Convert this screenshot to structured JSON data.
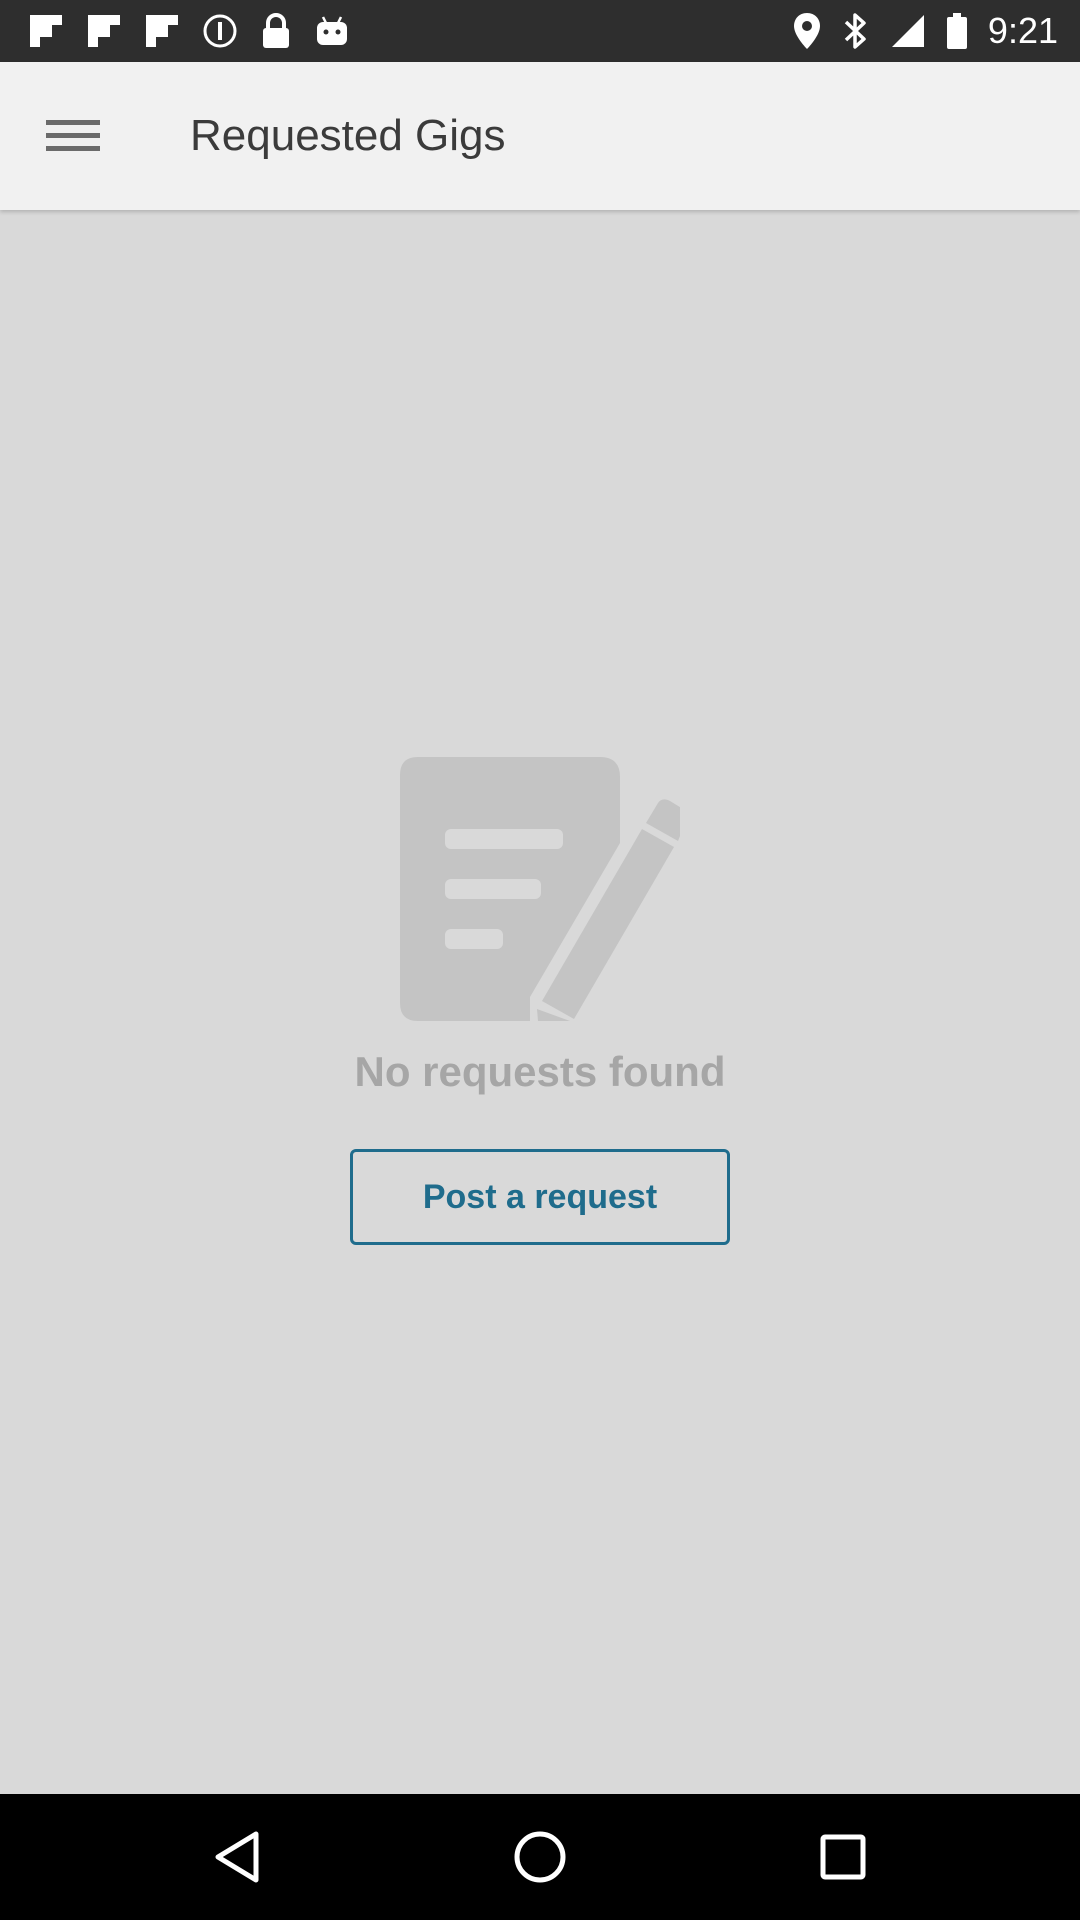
{
  "status_bar": {
    "time": "9:21",
    "left_icons": [
      "flipboard-icon",
      "flipboard-icon",
      "flipboard-icon",
      "info-icon",
      "lock-icon",
      "android-icon"
    ],
    "right_icons": [
      "location-icon",
      "bluetooth-icon",
      "signal-icon",
      "battery-icon"
    ]
  },
  "app_bar": {
    "title": "Requested Gigs",
    "menu_icon": "hamburger-menu-icon"
  },
  "empty_state": {
    "icon": "document-edit-icon",
    "message": "No requests found",
    "button_label": "Post a request"
  },
  "nav_bar": {
    "back_icon": "back-triangle-icon",
    "home_icon": "home-circle-icon",
    "recent_icon": "recent-apps-square-icon"
  },
  "colors": {
    "status_bar_bg": "#2e2e2e",
    "app_bar_bg": "#f1f1f1",
    "content_bg": "#d9d9d9",
    "accent": "#1f6c8c",
    "empty_text": "#a6a6a6",
    "nav_bar_bg": "#000000"
  }
}
